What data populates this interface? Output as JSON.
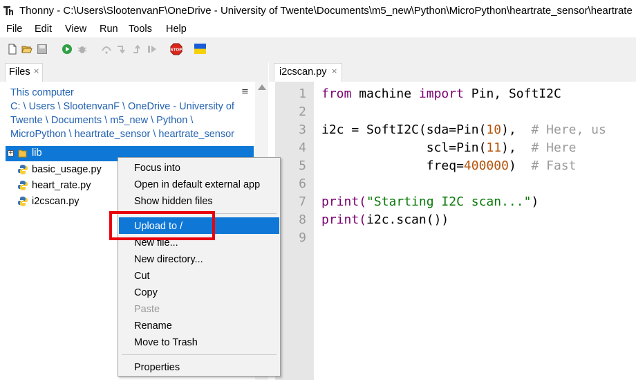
{
  "window": {
    "title": "Thonny  -  C:\\Users\\SlootenvanF\\OneDrive - University of Twente\\Documents\\m5_new\\Python\\MicroPython\\heartrate_sensor\\heartrate"
  },
  "menu": [
    "File",
    "Edit",
    "View",
    "Run",
    "Tools",
    "Help"
  ],
  "toolbar": {
    "icons": [
      "new-file-icon",
      "open-folder-icon",
      "save-icon",
      "run-icon",
      "debug-icon",
      "step-over-icon",
      "step-into-icon",
      "step-out-icon",
      "resume-icon",
      "stop-icon",
      "ukraine-flag-icon"
    ],
    "stop_label": "STOP"
  },
  "files_pane": {
    "tab_label": "Files",
    "close_glyph": "×",
    "location_label": "This computer",
    "path_lines": [
      "C: \\ Users \\ SlootenvanF \\ OneDrive - University of",
      "Twente \\ Documents \\ m5_new \\ Python \\",
      "MicroPython \\ heartrate_sensor \\ heartrate_sensor"
    ],
    "expand_glyph": "+",
    "menu_glyph": "≡",
    "items": [
      {
        "label": "lib",
        "type": "folder"
      },
      {
        "label": "basic_usage.py",
        "type": "python"
      },
      {
        "label": "heart_rate.py",
        "type": "python"
      },
      {
        "label": "i2cscan.py",
        "type": "python"
      }
    ]
  },
  "editor": {
    "tab_label": "i2cscan.py",
    "close_glyph": "×",
    "line_numbers": [
      "1",
      "2",
      "3",
      "4",
      "5",
      "6",
      "7",
      "8",
      "9"
    ],
    "lines": [
      [
        {
          "t": "from",
          "c": "kw"
        },
        {
          "t": " machine ",
          "c": ""
        },
        {
          "t": "import",
          "c": "kw"
        },
        {
          "t": " Pin, SoftI2C",
          "c": ""
        }
      ],
      [],
      [
        {
          "t": "i2c = SoftI2C(sda=Pin(",
          "c": ""
        },
        {
          "t": "10",
          "c": "num"
        },
        {
          "t": "),  ",
          "c": ""
        },
        {
          "t": "# Here, us",
          "c": "cmt"
        }
      ],
      [
        {
          "t": "              scl=Pin(",
          "c": ""
        },
        {
          "t": "11",
          "c": "num"
        },
        {
          "t": "),  ",
          "c": ""
        },
        {
          "t": "# Here",
          "c": "cmt"
        }
      ],
      [
        {
          "t": "              freq=",
          "c": ""
        },
        {
          "t": "400000",
          "c": "num"
        },
        {
          "t": ")  ",
          "c": ""
        },
        {
          "t": "# Fast",
          "c": "cmt"
        }
      ],
      [],
      [
        {
          "t": "print(",
          "c": "kw"
        },
        {
          "t": "\"Starting I2C scan...\"",
          "c": "str"
        },
        {
          "t": ")",
          "c": ""
        }
      ],
      [
        {
          "t": "print(",
          "c": "kw"
        },
        {
          "t": "i2c.scan())",
          "c": ""
        }
      ],
      []
    ]
  },
  "context_menu": {
    "items": [
      "Focus into",
      "Open in default external app",
      "Show hidden files",
      "Upload to /",
      "New file...",
      "New directory...",
      "Cut",
      "Copy",
      "Paste",
      "Rename",
      "Move to Trash",
      "Properties"
    ],
    "highlighted": "Upload to /",
    "disabled": [
      "Paste"
    ]
  },
  "colors": {
    "selection": "#0f78d7",
    "highlight_box": "#e8000c",
    "keyword": "#7a0070",
    "number": "#b5520a",
    "string": "#0a7a0a",
    "comment": "#9a9a9a",
    "path_link": "#2262b0"
  }
}
